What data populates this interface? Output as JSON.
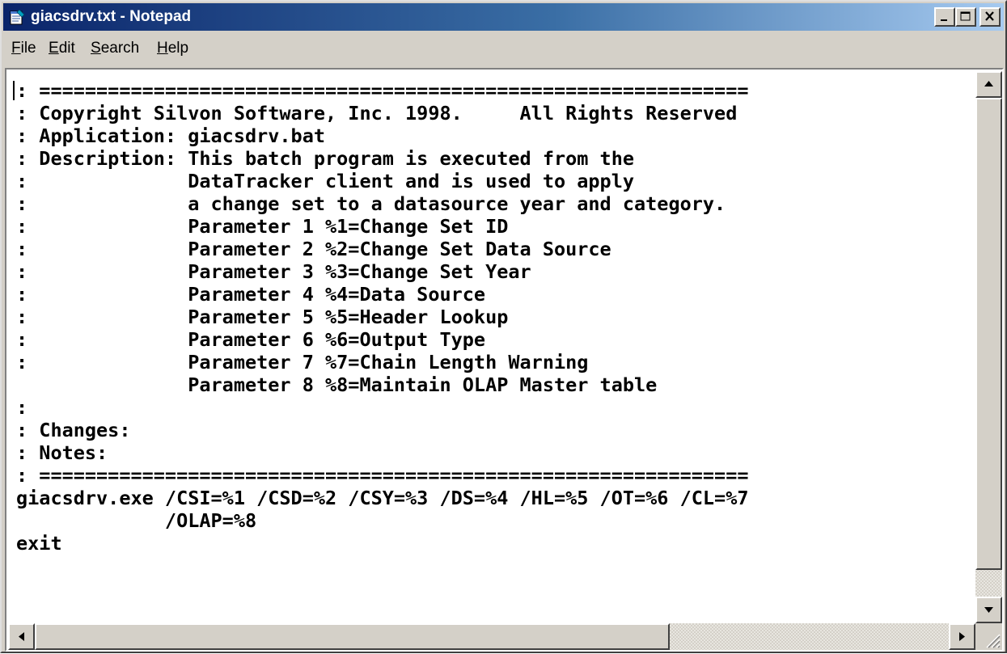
{
  "window": {
    "title": "giacsdrv.txt - Notepad",
    "colors": {
      "titlebar_start": "#0a246a",
      "titlebar_end": "#a6caf0",
      "chrome": "#d4d0c8",
      "text_bg": "#ffffff"
    }
  },
  "titlebar_icons": {
    "app": "notepad-icon",
    "minimize": "minimize-icon",
    "maximize": "maximize-icon",
    "close": "close-icon"
  },
  "menu": {
    "file": {
      "accel": "F",
      "rest": "ile"
    },
    "edit": {
      "accel": "E",
      "rest": "dit"
    },
    "search": {
      "accel": "S",
      "rest": "earch"
    },
    "help": {
      "accel": "H",
      "rest": "elp"
    }
  },
  "document": {
    "lines": [
      ": ==============================================================",
      ": Copyright Silvon Software, Inc. 1998.     All Rights Reserved",
      ": Application: giacsdrv.bat",
      ": Description: This batch program is executed from the",
      ":              DataTracker client and is used to apply",
      ":              a change set to a datasource year and category.",
      ":              Parameter 1 %1=Change Set ID",
      ":              Parameter 2 %2=Change Set Data Source",
      ":              Parameter 3 %3=Change Set Year",
      ":              Parameter 4 %4=Data Source",
      ":              Parameter 5 %5=Header Lookup",
      ":              Parameter 6 %6=Output Type",
      ":              Parameter 7 %7=Chain Length Warning",
      "               Parameter 8 %8=Maintain OLAP Master table",
      ":",
      ": Changes:",
      ": Notes:",
      ": ==============================================================",
      "giacsdrv.exe /CSI=%1 /CSD=%2 /CSY=%3 /DS=%4 /HL=%5 /OT=%6 /CL=%7",
      "             /OLAP=%8",
      "exit"
    ]
  },
  "scrollbar_icons": {
    "up": "arrow-up-icon",
    "down": "arrow-down-icon",
    "left": "arrow-left-icon",
    "right": "arrow-right-icon",
    "grip": "size-grip-icon"
  }
}
